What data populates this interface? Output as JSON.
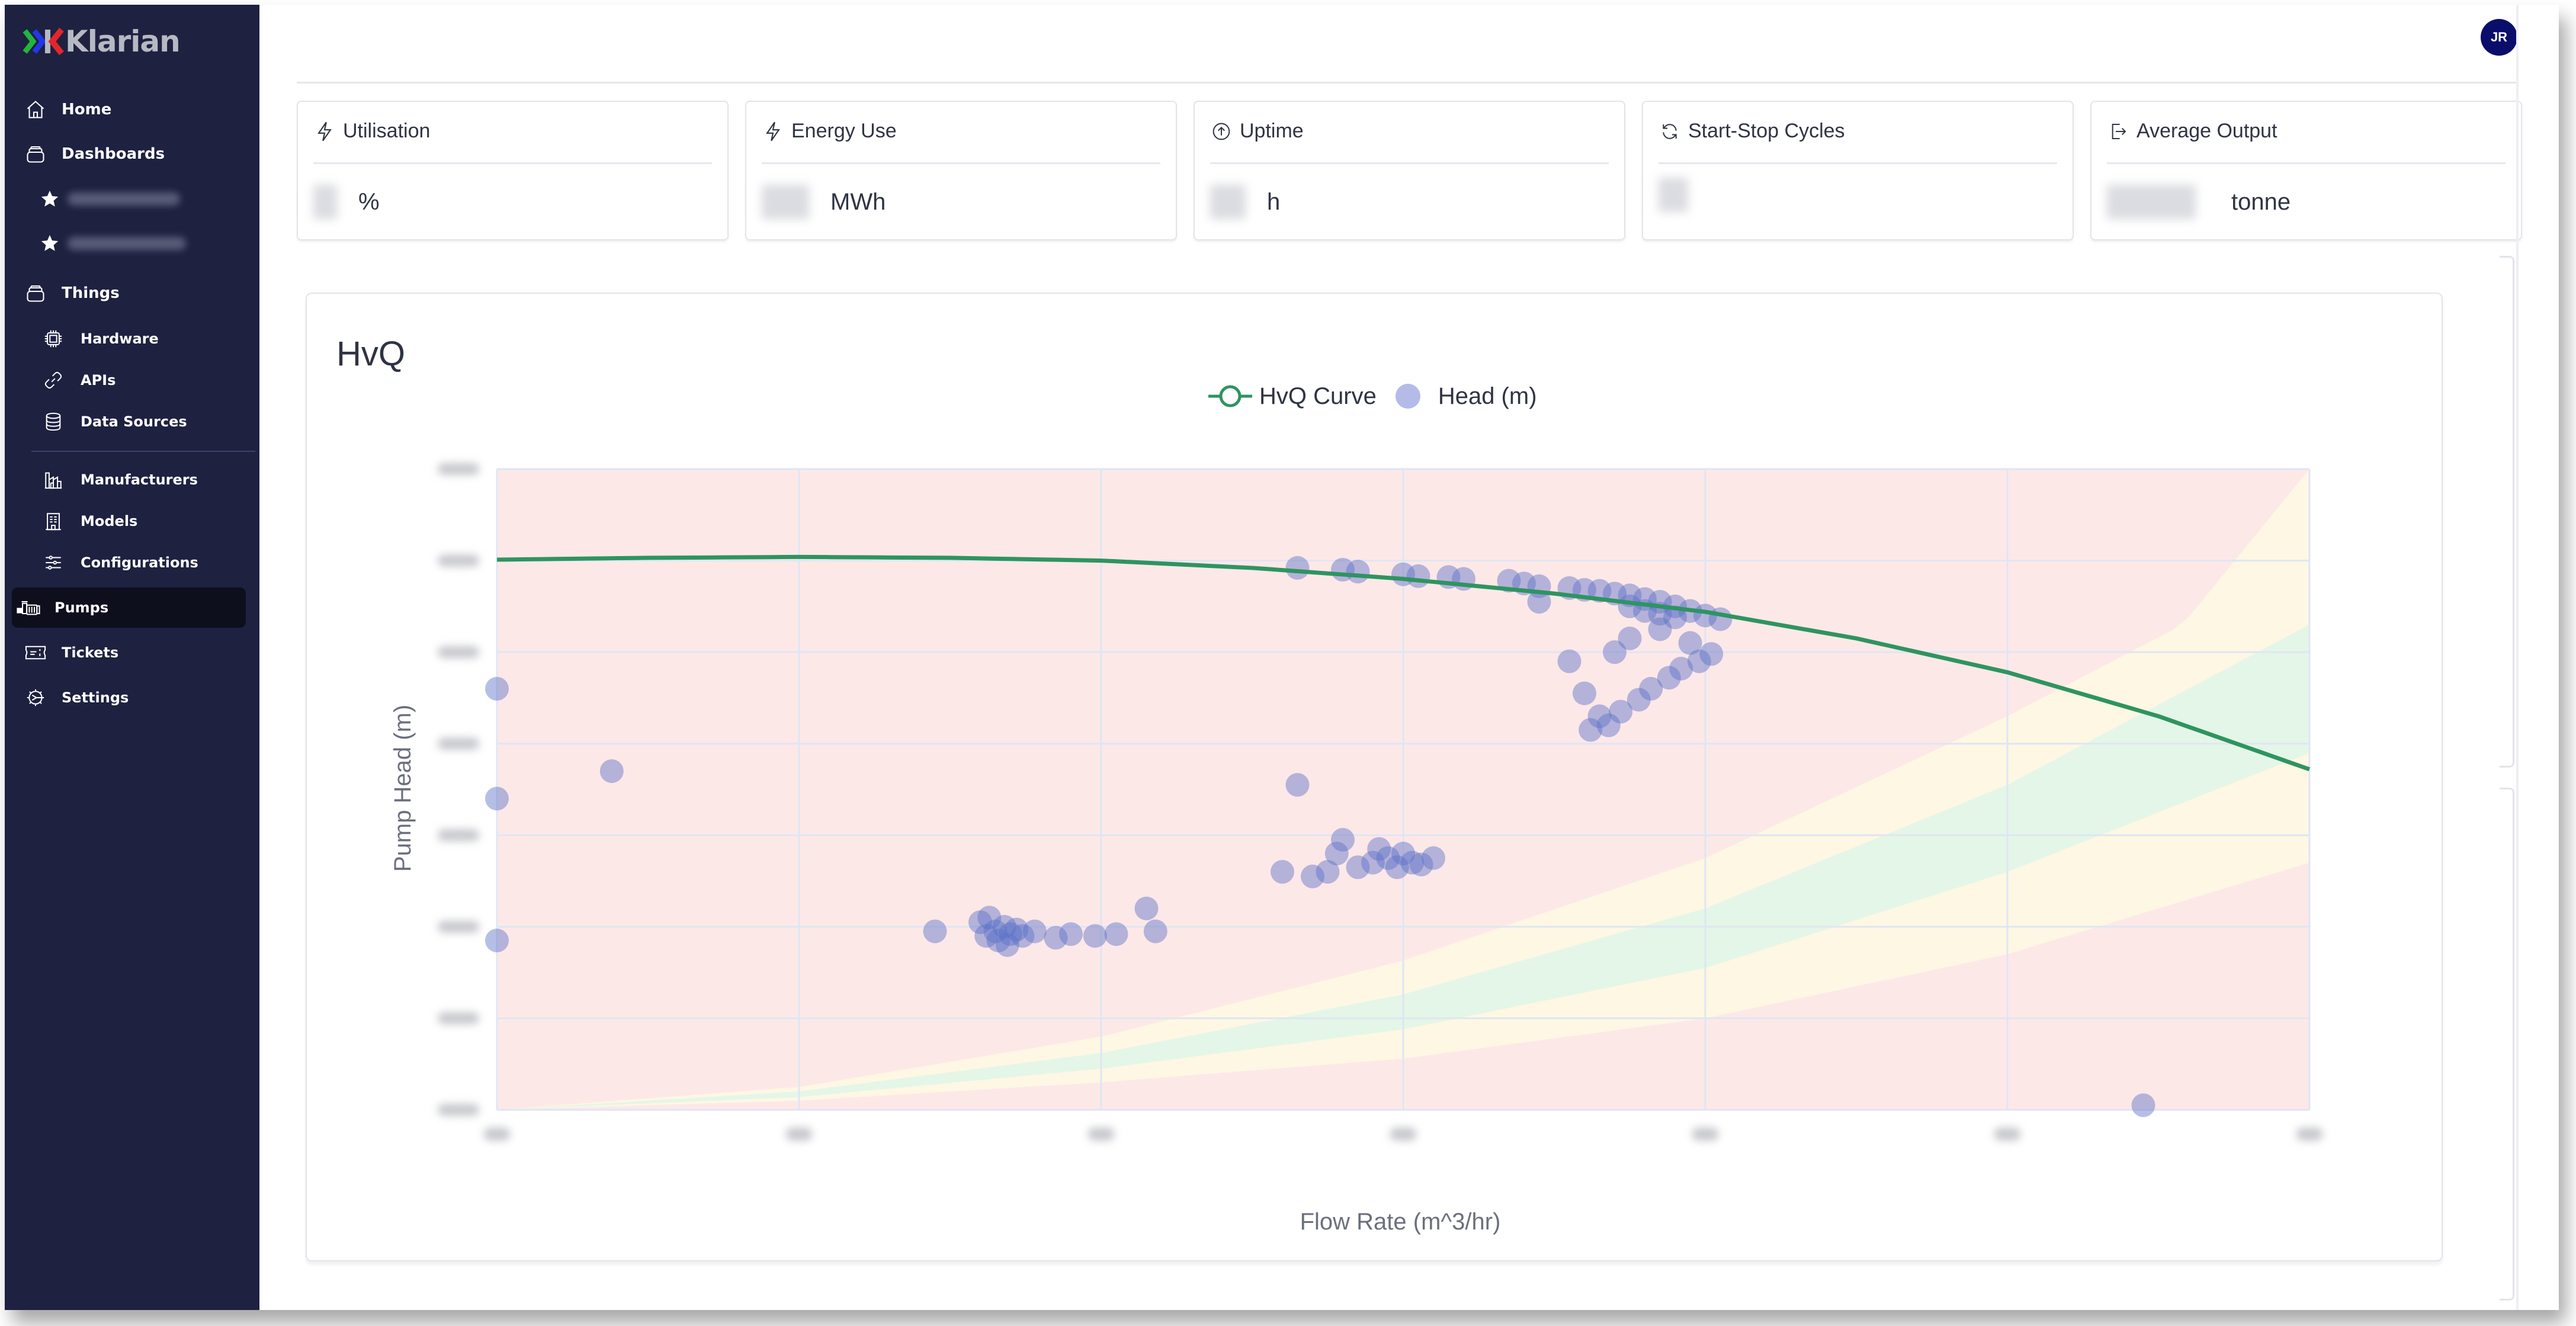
{
  "app": {
    "brand": "Klarian",
    "brand_colors": {
      "chevron1": "#22b53c",
      "chevron2": "#2436e8",
      "k": "#e3262c",
      "word": "#b7b9c2"
    }
  },
  "user": {
    "initials": "JR",
    "avatar_color": "#0b0d6b"
  },
  "sidebar": {
    "items": [
      {
        "label": "Home",
        "icon": "home-icon"
      },
      {
        "label": "Dashboards",
        "icon": "stack-icon"
      },
      {
        "label": "",
        "icon": "star-icon",
        "redacted": true
      },
      {
        "label": "",
        "icon": "star-icon",
        "redacted": true
      },
      {
        "label": "Things",
        "icon": "stack-icon"
      },
      {
        "label": "Hardware",
        "icon": "chip-icon"
      },
      {
        "label": "APIs",
        "icon": "link-icon"
      },
      {
        "label": "Data Sources",
        "icon": "database-icon"
      },
      {
        "label": "Manufacturers",
        "icon": "factory-icon"
      },
      {
        "label": "Models",
        "icon": "building-icon"
      },
      {
        "label": "Configurations",
        "icon": "sliders-icon"
      },
      {
        "label": "Pumps",
        "icon": "pump-icon",
        "active": true
      },
      {
        "label": "Tickets",
        "icon": "ticket-icon"
      },
      {
        "label": "Settings",
        "icon": "gear-icon"
      }
    ]
  },
  "stats": [
    {
      "title": "Utilisation",
      "icon": "lightning-icon",
      "value": "",
      "unit": "%"
    },
    {
      "title": "Energy Use",
      "icon": "lightning-icon",
      "value": "",
      "unit": "MWh"
    },
    {
      "title": "Uptime",
      "icon": "arrow-up-circle-icon",
      "value": "",
      "unit": "h"
    },
    {
      "title": "Start-Stop Cycles",
      "icon": "refresh-icon",
      "value": "",
      "unit": ""
    },
    {
      "title": "Average Output",
      "icon": "exit-icon",
      "value": "",
      "unit": "tonne"
    }
  ],
  "chart_card": {
    "title": "HvQ"
  },
  "chart_data": {
    "type": "scatter",
    "title": "HvQ",
    "xlabel": "Flow Rate (m^3/hr)",
    "ylabel": "Pump Head (m)",
    "x_tick_labels_redacted": true,
    "y_tick_labels_redacted": true,
    "x_grid_divisions": 6,
    "y_grid_divisions": 7,
    "xlim": [
      0,
      6
    ],
    "ylim": [
      0,
      7
    ],
    "units_note": "tick labels are blurred; values expressed in gridline units",
    "grid": true,
    "legend": {
      "position": "top-center",
      "entries": [
        {
          "name": "HvQ Curve",
          "color": "#2e9460",
          "marker": "line-open-circle"
        },
        {
          "name": "Head (m)",
          "color": "#b4bbe6",
          "marker": "circle"
        }
      ]
    },
    "zones": {
      "background_color": "#fde8e8",
      "bands": [
        {
          "name": "yellow-upper",
          "color": "#fdf7e4",
          "upper": [
            [
              0,
              0
            ],
            [
              1,
              0.25
            ],
            [
              2,
              0.8
            ],
            [
              3,
              1.63
            ],
            [
              4,
              2.75
            ],
            [
              5,
              4.3
            ],
            [
              5.58,
              5.3
            ],
            [
              6,
              7
            ]
          ],
          "lower": [
            [
              0,
              0
            ],
            [
              1,
              0.2
            ],
            [
              2,
              0.62
            ],
            [
              3,
              1.26
            ],
            [
              4,
              2.2
            ],
            [
              5,
              3.55
            ],
            [
              6,
              5.3
            ]
          ]
        },
        {
          "name": "green",
          "color": "#e4f6e7",
          "upper": [
            [
              0,
              0
            ],
            [
              1,
              0.2
            ],
            [
              2,
              0.62
            ],
            [
              3,
              1.26
            ],
            [
              4,
              2.2
            ],
            [
              5,
              3.55
            ],
            [
              6,
              5.3
            ]
          ],
          "lower": [
            [
              0,
              0
            ],
            [
              1,
              0.14
            ],
            [
              2,
              0.45
            ],
            [
              3,
              0.88
            ],
            [
              4,
              1.55
            ],
            [
              5,
              2.6
            ],
            [
              6,
              3.9
            ]
          ]
        },
        {
          "name": "yellow-lower",
          "color": "#fdf7e4",
          "upper": [
            [
              0,
              0
            ],
            [
              1,
              0.14
            ],
            [
              2,
              0.45
            ],
            [
              3,
              0.88
            ],
            [
              4,
              1.55
            ],
            [
              5,
              2.6
            ],
            [
              6,
              3.9
            ]
          ],
          "lower": [
            [
              0,
              0
            ],
            [
              1,
              0.1
            ],
            [
              2,
              0.3
            ],
            [
              3,
              0.56
            ],
            [
              4,
              1.0
            ],
            [
              5,
              1.7
            ],
            [
              6,
              2.7
            ]
          ]
        }
      ]
    },
    "series": [
      {
        "name": "HvQ Curve",
        "type": "line",
        "color": "#2e9460",
        "points": [
          [
            0,
            6.01
          ],
          [
            0.5,
            6.03
          ],
          [
            1,
            6.04
          ],
          [
            1.5,
            6.03
          ],
          [
            2,
            6.0
          ],
          [
            2.5,
            5.92
          ],
          [
            3,
            5.8
          ],
          [
            3.5,
            5.64
          ],
          [
            4,
            5.44
          ],
          [
            4.5,
            5.15
          ],
          [
            5,
            4.78
          ],
          [
            5.5,
            4.3
          ],
          [
            6,
            3.72
          ]
        ]
      },
      {
        "name": "Head (m)",
        "type": "scatter",
        "color": "#5a70c8",
        "opacity": 0.45,
        "points": [
          [
            0,
            4.6
          ],
          [
            0,
            3.4
          ],
          [
            0,
            1.85
          ],
          [
            0.38,
            3.7
          ],
          [
            2.65,
            3.55
          ],
          [
            5.45,
            0.05
          ],
          [
            1.45,
            1.95
          ],
          [
            1.6,
            2.05
          ],
          [
            1.62,
            1.9
          ],
          [
            1.65,
            1.95
          ],
          [
            1.68,
            2.0
          ],
          [
            1.66,
            1.85
          ],
          [
            1.7,
            1.92
          ],
          [
            1.72,
            1.97
          ],
          [
            1.74,
            1.9
          ],
          [
            1.63,
            2.1
          ],
          [
            1.69,
            1.8
          ],
          [
            1.78,
            1.95
          ],
          [
            1.85,
            1.88
          ],
          [
            1.9,
            1.92
          ],
          [
            1.98,
            1.9
          ],
          [
            2.05,
            1.92
          ],
          [
            2.15,
            2.2
          ],
          [
            2.18,
            1.95
          ],
          [
            2.6,
            2.6
          ],
          [
            2.7,
            2.55
          ],
          [
            2.75,
            2.6
          ],
          [
            2.78,
            2.8
          ],
          [
            2.85,
            2.65
          ],
          [
            2.9,
            2.7
          ],
          [
            2.95,
            2.75
          ],
          [
            2.98,
            2.65
          ],
          [
            3.0,
            2.8
          ],
          [
            3.03,
            2.7
          ],
          [
            2.92,
            2.85
          ],
          [
            3.06,
            2.68
          ],
          [
            2.8,
            2.95
          ],
          [
            3.1,
            2.75
          ],
          [
            2.65,
            5.92
          ],
          [
            2.8,
            5.9
          ],
          [
            2.85,
            5.88
          ],
          [
            3.0,
            5.85
          ],
          [
            3.05,
            5.83
          ],
          [
            3.15,
            5.82
          ],
          [
            3.2,
            5.8
          ],
          [
            3.35,
            5.78
          ],
          [
            3.4,
            5.75
          ],
          [
            3.45,
            5.72
          ],
          [
            3.55,
            5.7
          ],
          [
            3.6,
            5.68
          ],
          [
            3.65,
            5.67
          ],
          [
            3.7,
            5.64
          ],
          [
            3.75,
            5.62
          ],
          [
            3.8,
            5.58
          ],
          [
            3.85,
            5.55
          ],
          [
            3.9,
            5.5
          ],
          [
            3.95,
            5.45
          ],
          [
            4.0,
            5.4
          ],
          [
            3.75,
            5.5
          ],
          [
            3.8,
            5.45
          ],
          [
            3.85,
            5.42
          ],
          [
            4.05,
            5.36
          ],
          [
            3.9,
            5.38
          ],
          [
            3.45,
            5.55
          ],
          [
            3.55,
            4.9
          ],
          [
            3.6,
            4.55
          ],
          [
            3.65,
            4.3
          ],
          [
            3.62,
            4.15
          ],
          [
            3.68,
            4.2
          ],
          [
            3.72,
            4.35
          ],
          [
            3.78,
            4.48
          ],
          [
            3.82,
            4.6
          ],
          [
            3.88,
            4.72
          ],
          [
            3.92,
            4.82
          ],
          [
            3.98,
            4.9
          ],
          [
            4.02,
            4.98
          ],
          [
            3.7,
            5.0
          ],
          [
            3.75,
            5.15
          ],
          [
            3.85,
            5.25
          ],
          [
            3.95,
            5.1
          ]
        ]
      }
    ]
  },
  "axis_labels": {
    "x": "Flow Rate (m^3/hr)",
    "y": "Pump Head (m)"
  }
}
